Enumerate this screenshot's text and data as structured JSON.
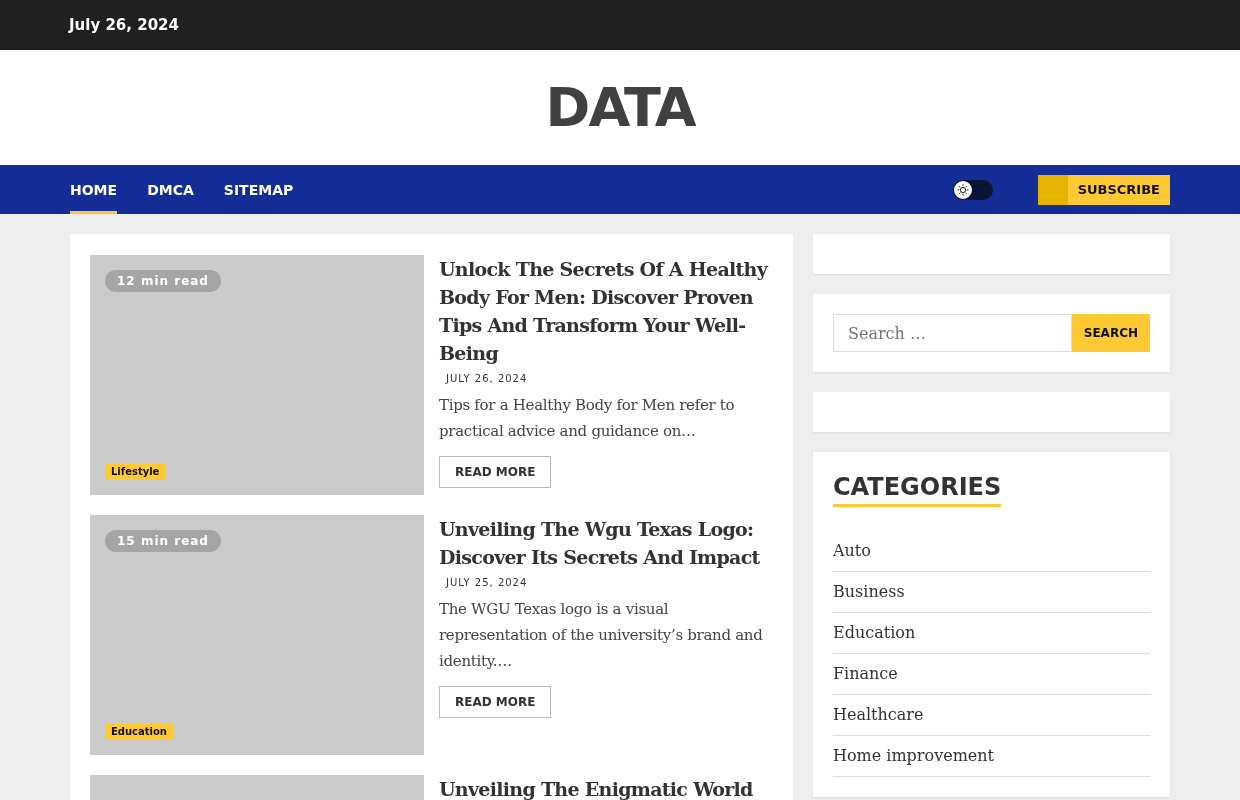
{
  "top_bar": {
    "date": "July 26, 2024"
  },
  "site_title": "DATA",
  "nav": {
    "items": [
      {
        "label": "HOME",
        "selected": true
      },
      {
        "label": "DMCA",
        "selected": false
      },
      {
        "label": "SITEMAP",
        "selected": false
      }
    ],
    "dark_mode_toggle": {
      "on": false
    },
    "subscribe_button": "SUBSCRIBE"
  },
  "articles": [
    {
      "read_time": "12 min read",
      "category": "Lifestyle",
      "title": "Unlock The Secrets Of A Healthy Body For Men: Discover Proven Tips And Transform Your Well-Being",
      "date": "JULY 26, 2024",
      "excerpt": "Tips for a Healthy Body for Men refer to practical advice and guidance on…",
      "button": "READ MORE"
    },
    {
      "read_time": "15 min read",
      "category": "Education",
      "title": "Unveiling The Wgu Texas Logo: Discover Its Secrets And Impact",
      "date": "JULY 25, 2024",
      "excerpt": "The WGU Texas logo is a visual representation of the university’s brand and identity.…",
      "button": "READ MORE"
    },
    {
      "title": "Unveiling The Enigmatic World"
    }
  ],
  "sidebar": {
    "search": {
      "placeholder": "Search …",
      "button": "SEARCH"
    },
    "categories": {
      "heading": "CATEGORIES",
      "items": [
        "Auto",
        "Business",
        "Education",
        "Finance",
        "Healthcare",
        "Home improvement"
      ]
    }
  }
}
